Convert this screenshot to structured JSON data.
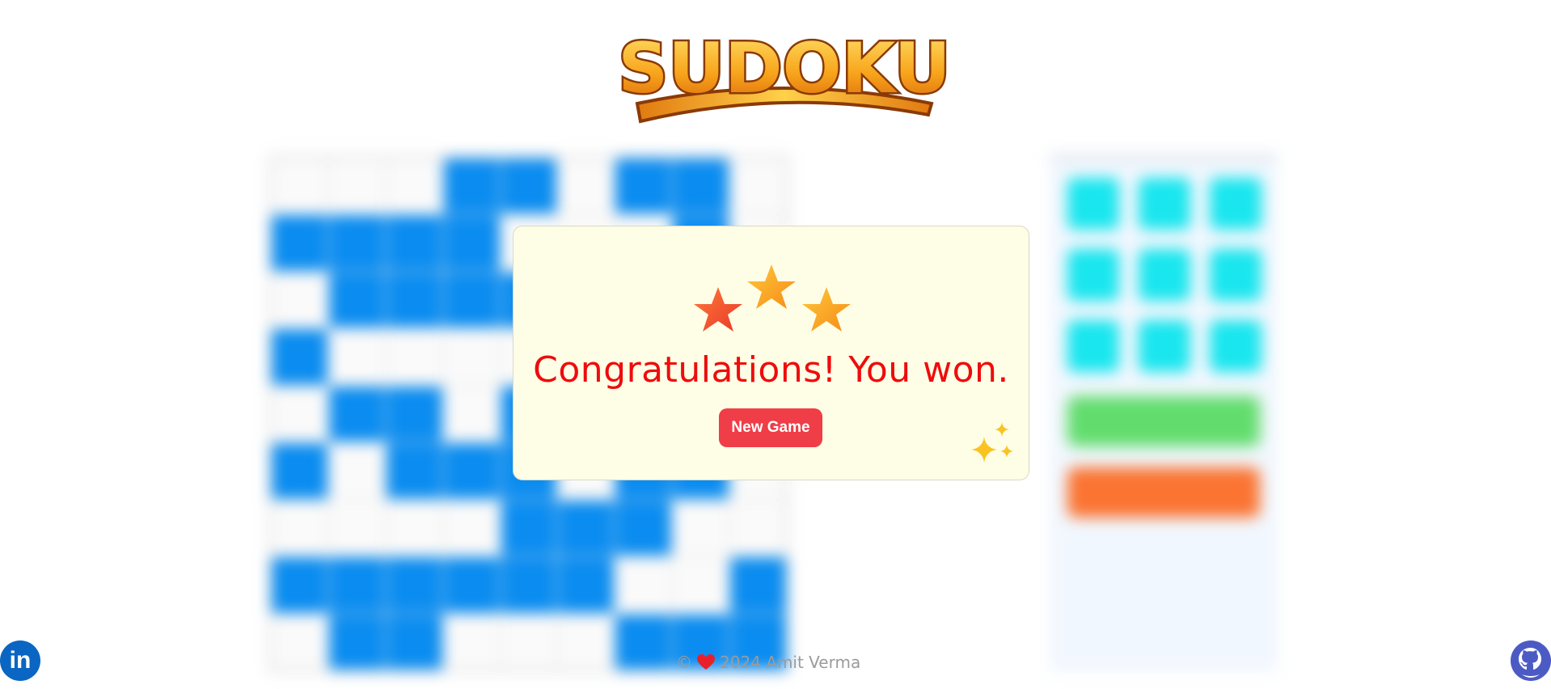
{
  "app": {
    "logo_text": "SUDOKU"
  },
  "board": {
    "colors": {
      "selected": "#0a8cf0",
      "empty": "#fafafa"
    },
    "cells": [
      [
        "w",
        "w",
        "w",
        "b",
        "b",
        "w",
        "b",
        "b",
        "w"
      ],
      [
        "b",
        "b",
        "b",
        "b",
        "w",
        "w",
        "w",
        "b",
        "w"
      ],
      [
        "w",
        "b",
        "b",
        "b",
        "b",
        "w",
        "b",
        "b",
        "w"
      ],
      [
        "b",
        "w",
        "w",
        "w",
        "w",
        "w",
        "w",
        "w",
        "w"
      ],
      [
        "w",
        "b",
        "b",
        "w",
        "b",
        "b",
        "b",
        "b",
        "w"
      ],
      [
        "b",
        "w",
        "b",
        "b",
        "b",
        "w",
        "b",
        "b",
        "w"
      ],
      [
        "w",
        "w",
        "w",
        "w",
        "b",
        "b",
        "b",
        "w",
        "w"
      ],
      [
        "b",
        "b",
        "b",
        "b",
        "b",
        "b",
        "w",
        "w",
        "b"
      ],
      [
        "w",
        "b",
        "b",
        "w",
        "w",
        "w",
        "b",
        "b",
        "b"
      ]
    ]
  },
  "side_panel": {
    "numpad_keys": [
      "",
      "",
      "",
      "",
      "",
      "",
      "",
      "",
      ""
    ],
    "green_button_label": "",
    "orange_button_label": "",
    "colors": {
      "numpad": "#19e6ee",
      "green": "#62dd6d",
      "orange": "#fb7432"
    }
  },
  "modal": {
    "message": "Congratulations! You won.",
    "new_game_label": "New Game",
    "colors": {
      "message": "#ee0c0c",
      "button": "#ef3e48",
      "background": "#fefee6"
    }
  },
  "footer": {
    "copyright_symbol": "©",
    "year_author": "2024 Amit Verma"
  },
  "social": {
    "linkedin_label": "in"
  },
  "icons": [
    "star-icon",
    "sparkles-icon",
    "heart-icon",
    "linkedin-icon",
    "github-icon"
  ]
}
